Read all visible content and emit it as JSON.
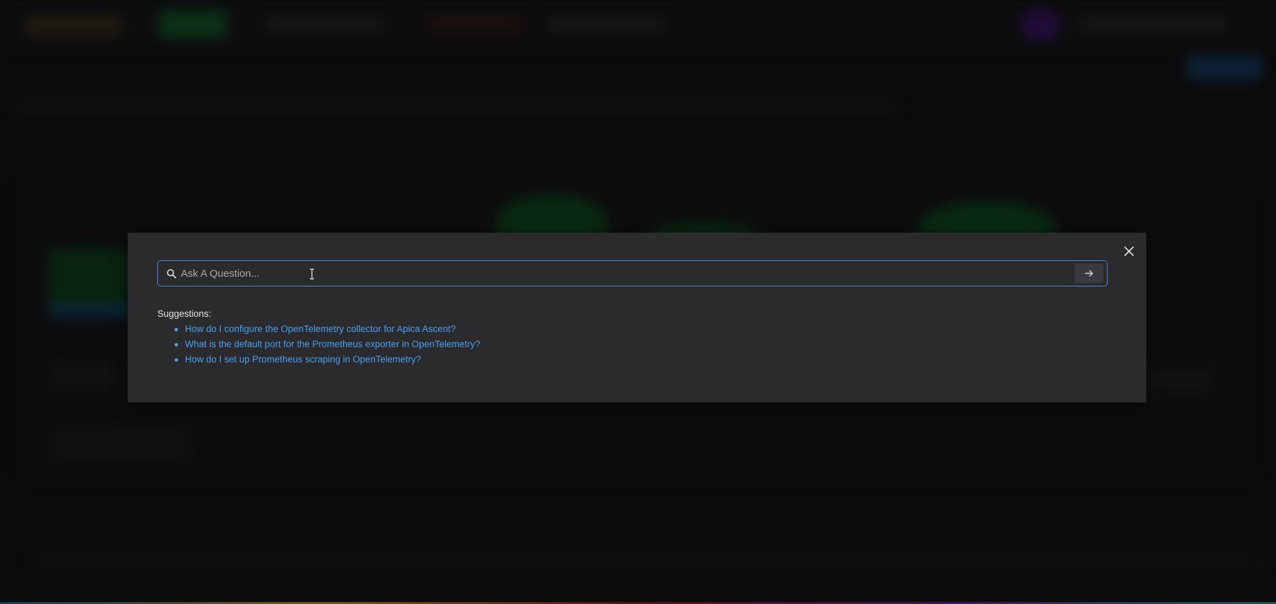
{
  "search": {
    "placeholder": "Ask A Question...",
    "value": ""
  },
  "suggestions": {
    "label": "Suggestions:",
    "items": [
      "How do I configure the OpenTelemetry collector for Apica Ascent?",
      "What is the default port for the Prometheus exporter in OpenTelemetry?",
      "How do I set up Prometheus scraping in OpenTelemetry?"
    ]
  },
  "icons": {
    "search": "search-icon",
    "close": "close-icon",
    "submit": "arrow-right-icon",
    "cursor": "text-cursor-icon"
  },
  "colors": {
    "accent": "#3b8be0",
    "link": "#4a9ff0",
    "modal_bg": "#2b2b2d"
  }
}
